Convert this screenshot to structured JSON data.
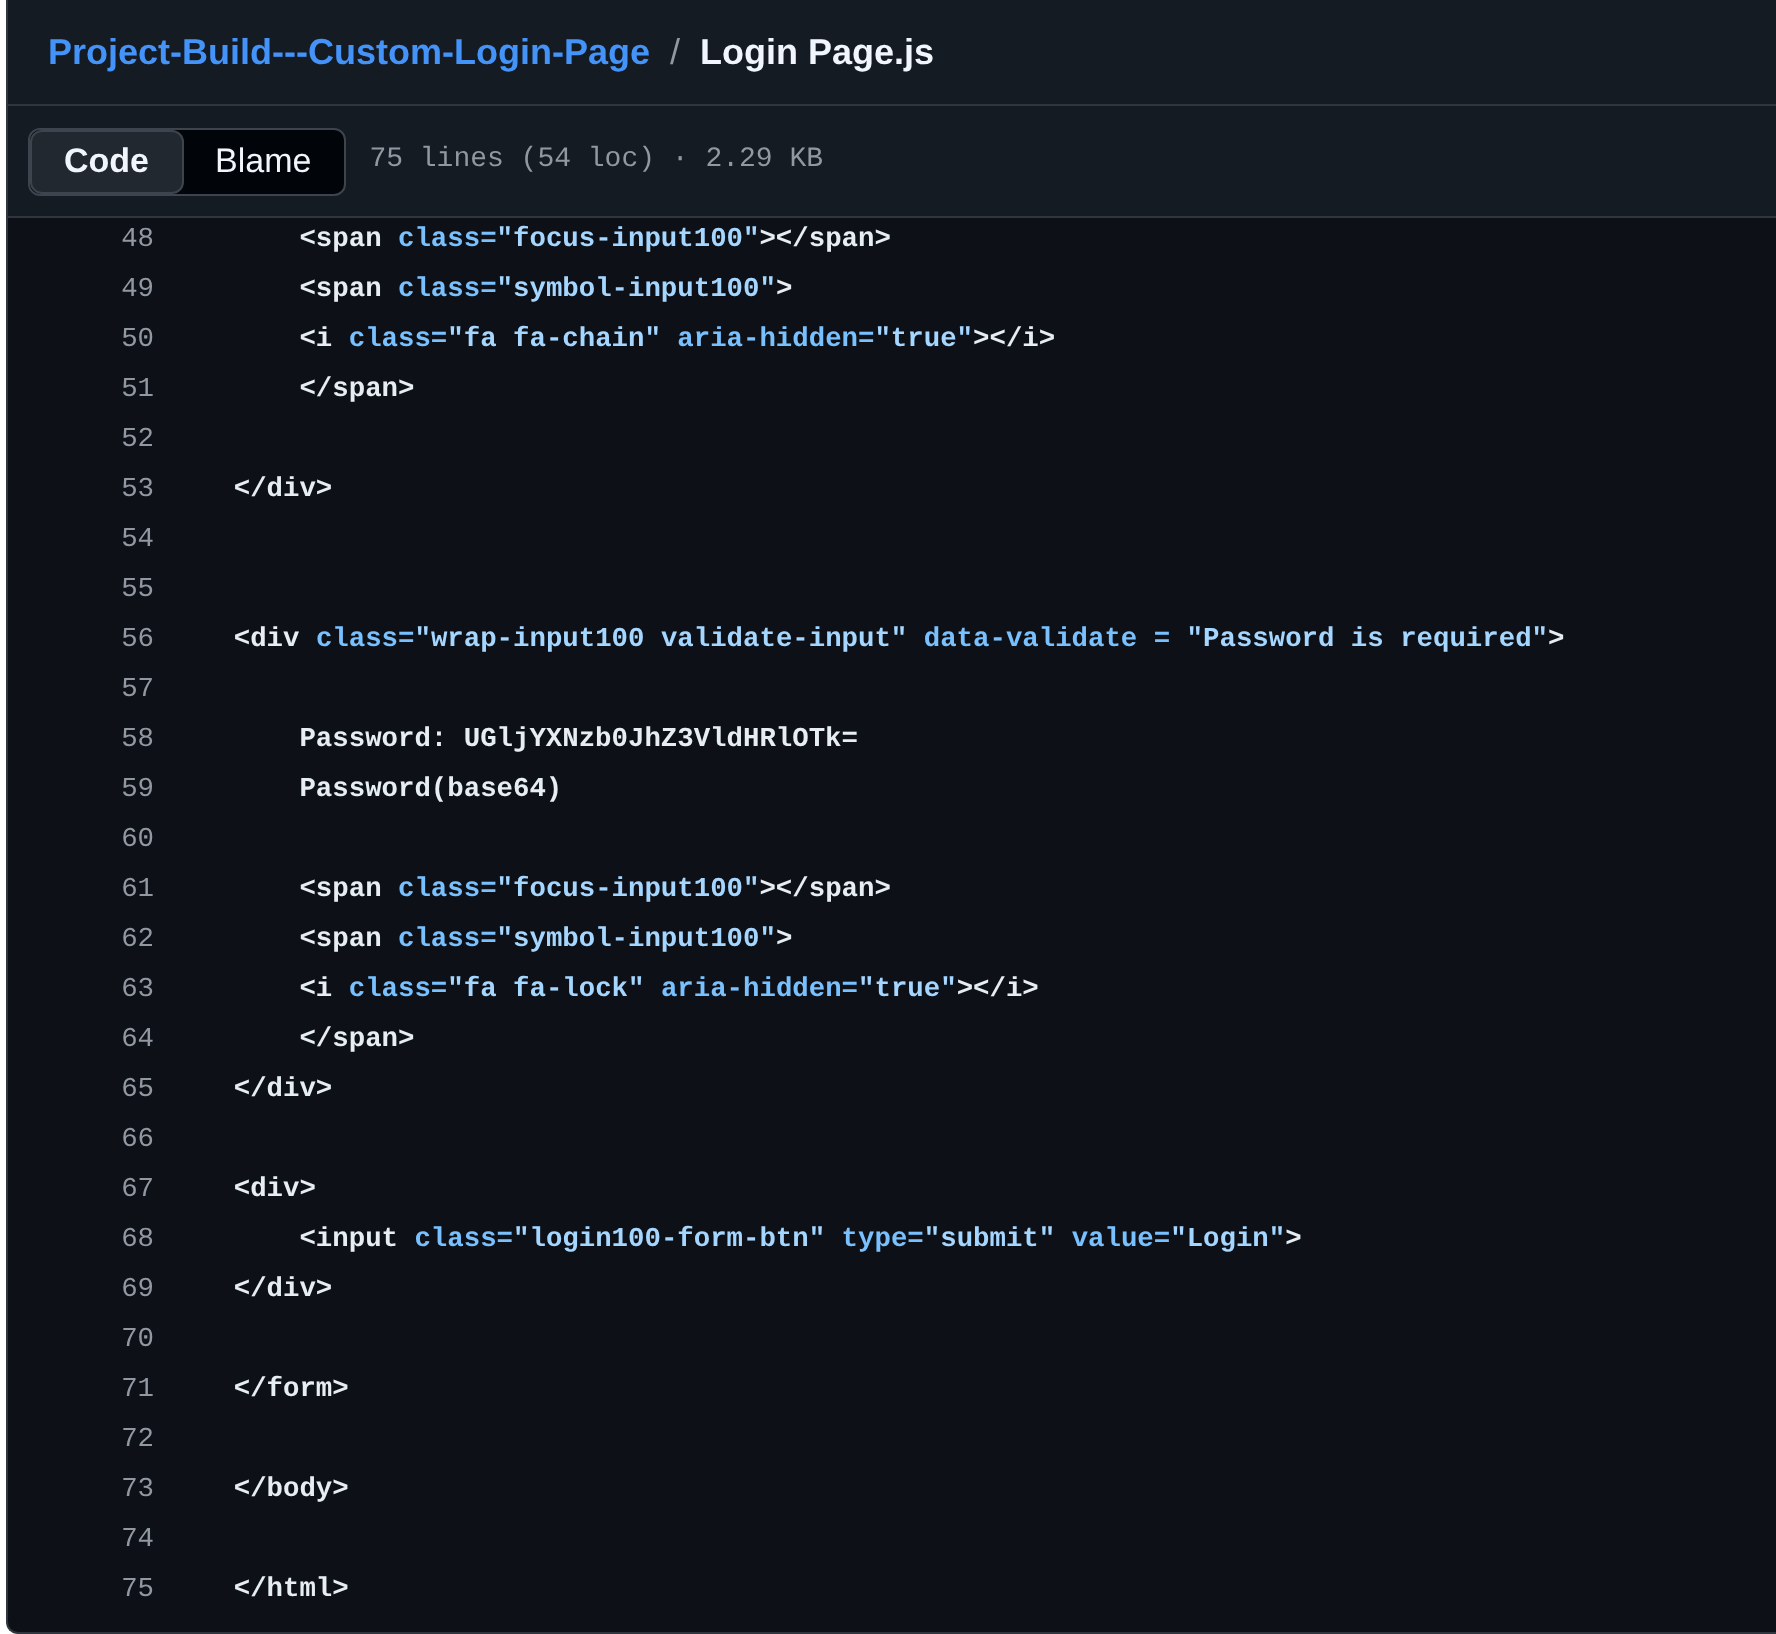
{
  "breadcrumb": {
    "repo": "Project-Build---Custom-Login-Page",
    "separator": "/",
    "file": "Login Page.js"
  },
  "tabs": [
    {
      "label": "Code",
      "selected": true
    },
    {
      "label": "Blame",
      "selected": false
    }
  ],
  "file_info": "75 lines (54 loc) · 2.29 KB",
  "lines": [
    {
      "number": "48",
      "tokens": [
        {
          "kind": "tag",
          "text": "        <span "
        },
        {
          "kind": "attr",
          "text": "class="
        },
        {
          "kind": "string",
          "text": "\"focus-input100\""
        },
        {
          "kind": "tag",
          "text": "></span>"
        }
      ]
    },
    {
      "number": "49",
      "tokens": [
        {
          "kind": "tag",
          "text": "        <span "
        },
        {
          "kind": "attr",
          "text": "class="
        },
        {
          "kind": "string",
          "text": "\"symbol-input100\""
        },
        {
          "kind": "tag",
          "text": ">"
        }
      ]
    },
    {
      "number": "50",
      "tokens": [
        {
          "kind": "tag",
          "text": "        <i "
        },
        {
          "kind": "attr",
          "text": "class="
        },
        {
          "kind": "string",
          "text": "\"fa fa-chain\""
        },
        {
          "kind": "attr",
          "text": " aria-hidden="
        },
        {
          "kind": "string",
          "text": "\"true\""
        },
        {
          "kind": "tag",
          "text": "></i>"
        }
      ]
    },
    {
      "number": "51",
      "tokens": [
        {
          "kind": "tag",
          "text": "        </span>"
        }
      ]
    },
    {
      "number": "52"
    },
    {
      "number": "53",
      "tokens": [
        {
          "kind": "tag",
          "text": "    </div>"
        }
      ]
    },
    {
      "number": "54"
    },
    {
      "number": "55"
    },
    {
      "number": "56",
      "tokens": [
        {
          "kind": "tag",
          "text": "    <div "
        },
        {
          "kind": "attr",
          "text": "class="
        },
        {
          "kind": "string",
          "text": "\"wrap-input100 validate-input\""
        },
        {
          "kind": "attr",
          "text": " data-validate = "
        },
        {
          "kind": "string",
          "text": "\"Password is required\""
        },
        {
          "kind": "tag",
          "text": ">"
        }
      ]
    },
    {
      "number": "57"
    },
    {
      "number": "58",
      "tokens": [
        {
          "kind": "tag",
          "text": "        Password: UGljYXNzb0JhZ3VldHRlOTk="
        }
      ]
    },
    {
      "number": "59",
      "tokens": [
        {
          "kind": "tag",
          "text": "        Password(base64)"
        }
      ]
    },
    {
      "number": "60"
    },
    {
      "number": "61",
      "tokens": [
        {
          "kind": "tag",
          "text": "        <span "
        },
        {
          "kind": "attr",
          "text": "class="
        },
        {
          "kind": "string",
          "text": "\"focus-input100\""
        },
        {
          "kind": "tag",
          "text": "></span>"
        }
      ]
    },
    {
      "number": "62",
      "tokens": [
        {
          "kind": "tag",
          "text": "        <span "
        },
        {
          "kind": "attr",
          "text": "class="
        },
        {
          "kind": "string",
          "text": "\"symbol-input100\""
        },
        {
          "kind": "tag",
          "text": ">"
        }
      ]
    },
    {
      "number": "63",
      "tokens": [
        {
          "kind": "tag",
          "text": "        <i "
        },
        {
          "kind": "attr",
          "text": "class="
        },
        {
          "kind": "string",
          "text": "\"fa fa-lock\""
        },
        {
          "kind": "attr",
          "text": " aria-hidden="
        },
        {
          "kind": "string",
          "text": "\"true\""
        },
        {
          "kind": "tag",
          "text": "></i>"
        }
      ]
    },
    {
      "number": "64",
      "tokens": [
        {
          "kind": "tag",
          "text": "        </span>"
        }
      ]
    },
    {
      "number": "65",
      "tokens": [
        {
          "kind": "tag",
          "text": "    </div>"
        }
      ]
    },
    {
      "number": "66"
    },
    {
      "number": "67",
      "tokens": [
        {
          "kind": "tag",
          "text": "    <div>"
        }
      ]
    },
    {
      "number": "68",
      "tokens": [
        {
          "kind": "tag",
          "text": "        <input "
        },
        {
          "kind": "attr",
          "text": "class="
        },
        {
          "kind": "string",
          "text": "\"login100-form-btn\""
        },
        {
          "kind": "attr",
          "text": " type="
        },
        {
          "kind": "string",
          "text": "\"submit\""
        },
        {
          "kind": "attr",
          "text": " value="
        },
        {
          "kind": "string",
          "text": "\"Login\""
        },
        {
          "kind": "tag",
          "text": ">"
        }
      ]
    },
    {
      "number": "69",
      "tokens": [
        {
          "kind": "tag",
          "text": "    </div>"
        }
      ]
    },
    {
      "number": "70"
    },
    {
      "number": "71",
      "tokens": [
        {
          "kind": "tag",
          "text": "    </form>"
        }
      ]
    },
    {
      "number": "72"
    },
    {
      "number": "73",
      "tokens": [
        {
          "kind": "tag",
          "text": "    </body>"
        }
      ]
    },
    {
      "number": "74"
    },
    {
      "number": "75",
      "tokens": [
        {
          "kind": "tag",
          "text": "    </html>"
        }
      ]
    }
  ]
}
